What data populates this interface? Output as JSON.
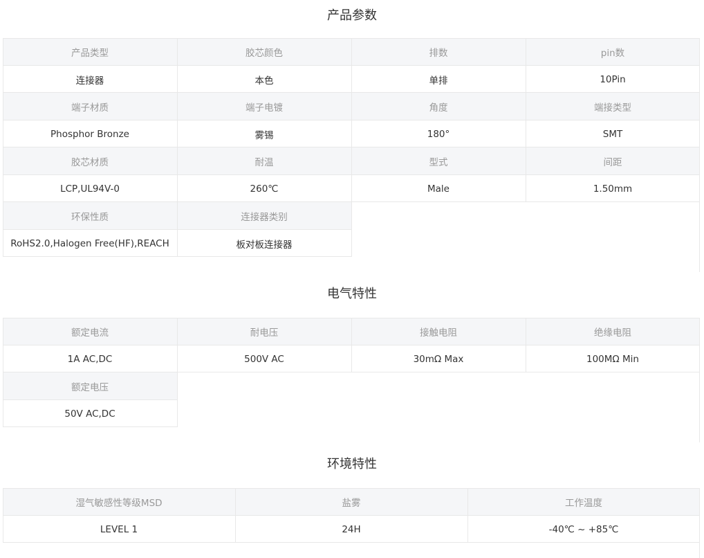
{
  "product_params": {
    "title": "产品参数",
    "rows": [
      {
        "headers": [
          "产品类型",
          "胶芯颜色",
          "排数",
          "pin数"
        ],
        "values": [
          "连接器",
          "本色",
          "单排",
          "10Pin"
        ]
      },
      {
        "headers": [
          "端子材质",
          "端子电镀",
          "角度",
          "端接类型"
        ],
        "values": [
          "Phosphor Bronze",
          "雾锡",
          "180°",
          "SMT"
        ]
      },
      {
        "headers": [
          "胶芯材质",
          "耐温",
          "型式",
          "间距"
        ],
        "values": [
          "LCP,UL94V-0",
          "260℃",
          "Male",
          "1.50mm"
        ]
      },
      {
        "headers": [
          "环保性质",
          "连接器类别"
        ],
        "values": [
          "RoHS2.0,Halogen Free(HF),REACH",
          "板对板连接器"
        ]
      }
    ]
  },
  "electrical": {
    "title": "电气特性",
    "rows": [
      {
        "headers": [
          "额定电流",
          "耐电压",
          "接触电阻",
          "绝缘电阻"
        ],
        "values": [
          "1A AC,DC",
          "500V AC",
          "30mΩ Max",
          "100MΩ Min"
        ]
      },
      {
        "headers": [
          "额定电压"
        ],
        "values": [
          "50V AC,DC"
        ]
      }
    ]
  },
  "environmental": {
    "title": "环境特性",
    "rows": [
      {
        "headers": [
          "湿气敏感性等级MSD",
          "盐雾",
          "工作温度"
        ],
        "values": [
          "LEVEL 1",
          "24H",
          "-40℃ ~ +85℃"
        ]
      }
    ]
  }
}
